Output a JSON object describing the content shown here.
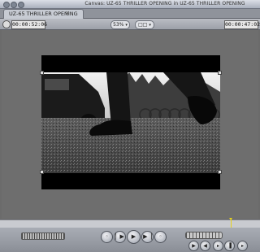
{
  "window": {
    "title": "Canvas: UZ-65 THRILLER OPENING in UZ-65 THRILLER OPENING"
  },
  "tabs": [
    {
      "label": "UZ-65 THRILLER OPENING"
    }
  ],
  "toolbar": {
    "duration": "00:00:52:06",
    "zoom": "53%",
    "view_options": "□□",
    "current_timecode": "00:00:47:02"
  },
  "transport": {
    "buttons": [
      "mark-clip",
      "play-in-to-out",
      "play",
      "play-around-current",
      "mark-in",
      "mark-out"
    ]
  },
  "icons": {
    "clock": "clock-icon",
    "close": "close-icon"
  },
  "colors": {
    "canvas_bg": "#6e6e6e",
    "playhead": "#e6d21b"
  }
}
